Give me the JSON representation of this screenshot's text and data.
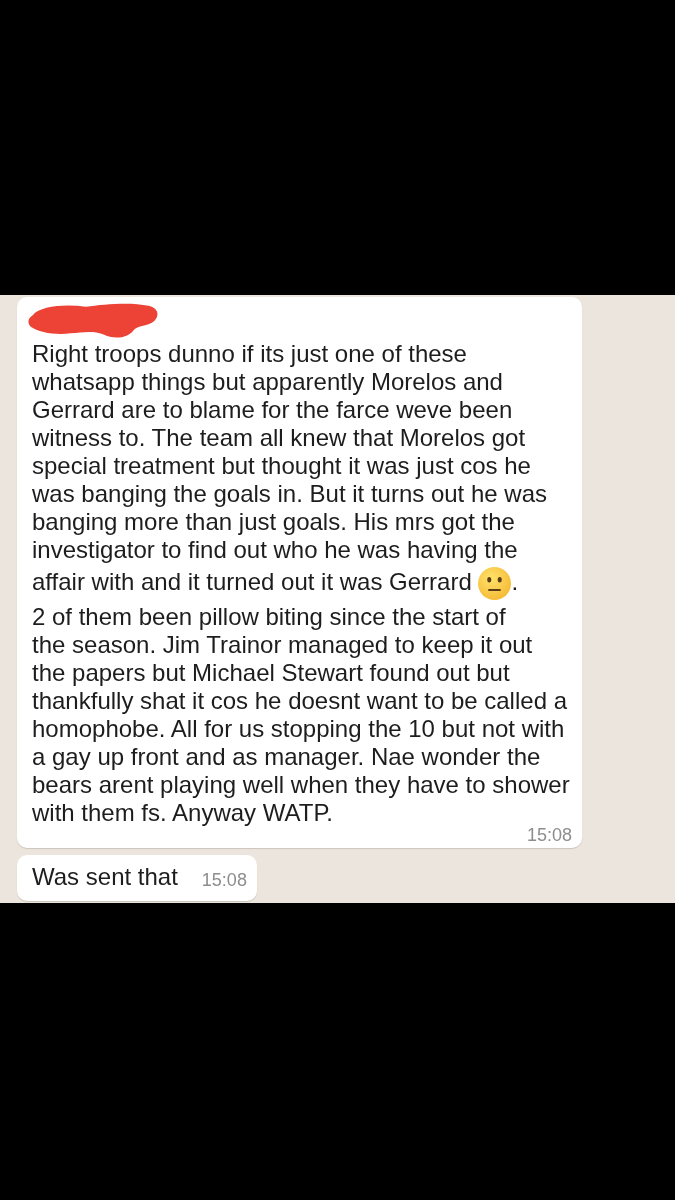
{
  "chat": {
    "messages": [
      {
        "sender_redacted": true,
        "body": [
          {
            "kind": "text",
            "text": "Right troops dunno if its just one of these\nwhatsapp things but apparently Morelos and\nGerrard are to blame for the farce weve been\nwitness to. The team all knew that Morelos got\nspecial treatment but thought it was just cos he\nwas banging the goals in. But it turns out he was\nbanging more than just goals. His mrs got the\ninvestigator to find out who he was having the\naffair with and it turned out it was Gerrard "
          },
          {
            "kind": "emoji"
          },
          {
            "kind": "text",
            "text": ".\n2 of them been pillow biting since the start of\nthe season. Jim Trainor managed to keep it out\nthe papers but Michael Stewart found out but\nthankfully shat it cos he doesnt want to be called a\nhomophobe. All for us stopping the 10 but not with\na gay up front and as manager. Nae wonder the\nbears arent playing well when they have to shower\nwith them fs. Anyway WATP."
          }
        ],
        "time": "15:08"
      },
      {
        "sender_redacted": false,
        "body": [
          {
            "kind": "text",
            "text": "Was sent that"
          }
        ],
        "time": "15:08"
      }
    ]
  }
}
